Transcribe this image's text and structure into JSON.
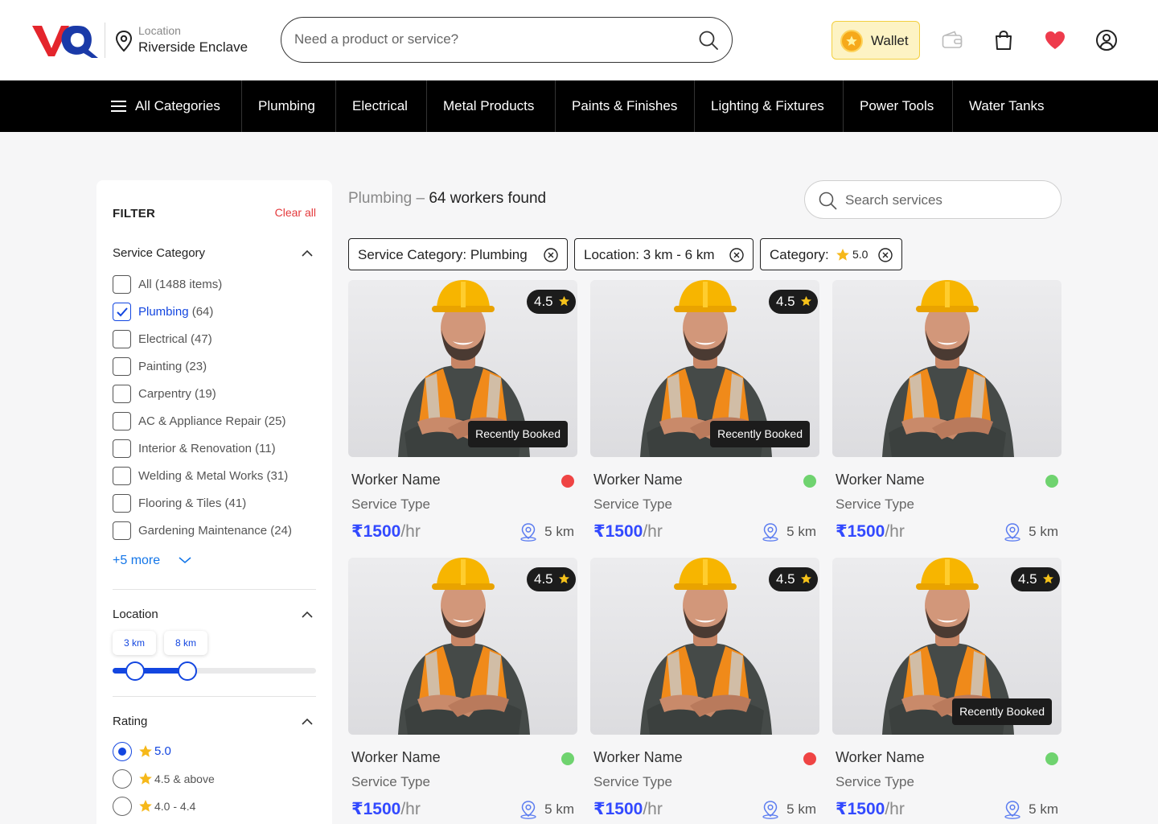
{
  "header": {
    "location_label": "Location",
    "location_value": "Riverside Enclave",
    "search_placeholder": "Need a product or service?",
    "wallet_label": "Wallet"
  },
  "nav": {
    "all_categories": "All Categories",
    "items": [
      "Plumbing",
      "Electrical",
      "Metal Products",
      "Paints & Finishes",
      "Lighting & Fixtures",
      "Power Tools",
      "Water Tanks"
    ]
  },
  "filter": {
    "title": "FILTER",
    "clear_all": "Clear all",
    "service_category": {
      "title": "Service Category",
      "items": [
        {
          "label": "All",
          "count": "(1488 items)",
          "checked": false
        },
        {
          "label": "Plumbing",
          "count": "(64)",
          "checked": true
        },
        {
          "label": "Electrical",
          "count": "(47)",
          "checked": false
        },
        {
          "label": "Painting",
          "count": "(23)",
          "checked": false
        },
        {
          "label": "Carpentry",
          "count": "(19)",
          "checked": false
        },
        {
          "label": "AC & Appliance Repair",
          "count": "(25)",
          "checked": false
        },
        {
          "label": "Interior & Renovation",
          "count": "(11)",
          "checked": false
        },
        {
          "label": "Welding & Metal Works",
          "count": "(31)",
          "checked": false
        },
        {
          "label": "Flooring & Tiles",
          "count": "(41)",
          "checked": false
        },
        {
          "label": "Gardening Maintenance",
          "count": "(24)",
          "checked": false
        }
      ],
      "more": "+5 more"
    },
    "location": {
      "title": "Location",
      "min_label": "3 km",
      "max_label": "8 km",
      "min_value": 3,
      "max_value": 8
    },
    "rating": {
      "title": "Rating",
      "options": [
        {
          "label": "5.0",
          "selected": true
        },
        {
          "label": "4.5 & above",
          "selected": false
        },
        {
          "label": "4.0 - 4.4",
          "selected": false
        }
      ]
    }
  },
  "results": {
    "category": "Plumbing",
    "separator": " – ",
    "count_text": "64 workers found",
    "search_placeholder": "Search services",
    "chips": [
      {
        "label": "Service Category: Plumbing"
      },
      {
        "label": "Location: 3 km - 6 km"
      },
      {
        "label": "Category:",
        "value": "5.0"
      }
    ],
    "cards": [
      {
        "rating": "4.5",
        "booked": "Recently Booked",
        "name": "Worker Name",
        "type": "Service Type",
        "price": "₹1500",
        "unit": "/hr",
        "distance": "5 km",
        "status": "busy",
        "status_color": "#ef4444"
      },
      {
        "rating": "4.5",
        "booked": "Recently Booked",
        "name": "Worker Name",
        "type": "Service Type",
        "price": "₹1500",
        "unit": "/hr",
        "distance": "5 km",
        "status": "available",
        "status_color": "#6fd36f"
      },
      {
        "rating": "",
        "booked": "",
        "name": "Worker Name",
        "type": "Service Type",
        "price": "₹1500",
        "unit": "/hr",
        "distance": "5 km",
        "status": "available",
        "status_color": "#6fd36f"
      },
      {
        "rating": "4.5",
        "booked": "",
        "name": "Worker Name",
        "type": "Service Type",
        "price": "₹1500",
        "unit": "/hr",
        "distance": "5 km",
        "status": "available",
        "status_color": "#6fd36f"
      },
      {
        "rating": "4.5",
        "booked": "",
        "name": "Worker Name",
        "type": "Service Type",
        "price": "₹1500",
        "unit": "/hr",
        "distance": "5 km",
        "status": "busy",
        "status_color": "#ef4444"
      },
      {
        "rating": "4.5",
        "booked": "Recently Booked",
        "name": "Worker Name",
        "type": "Service Type",
        "price": "₹1500",
        "unit": "/hr",
        "distance": "5 km",
        "status": "available",
        "status_color": "#6fd36f"
      }
    ]
  },
  "colors": {
    "accent": "#1346e0",
    "price": "#3249ff",
    "nav_bg": "#000000",
    "wallet_bg": "#fdf3c4",
    "danger": "#e4393c"
  }
}
